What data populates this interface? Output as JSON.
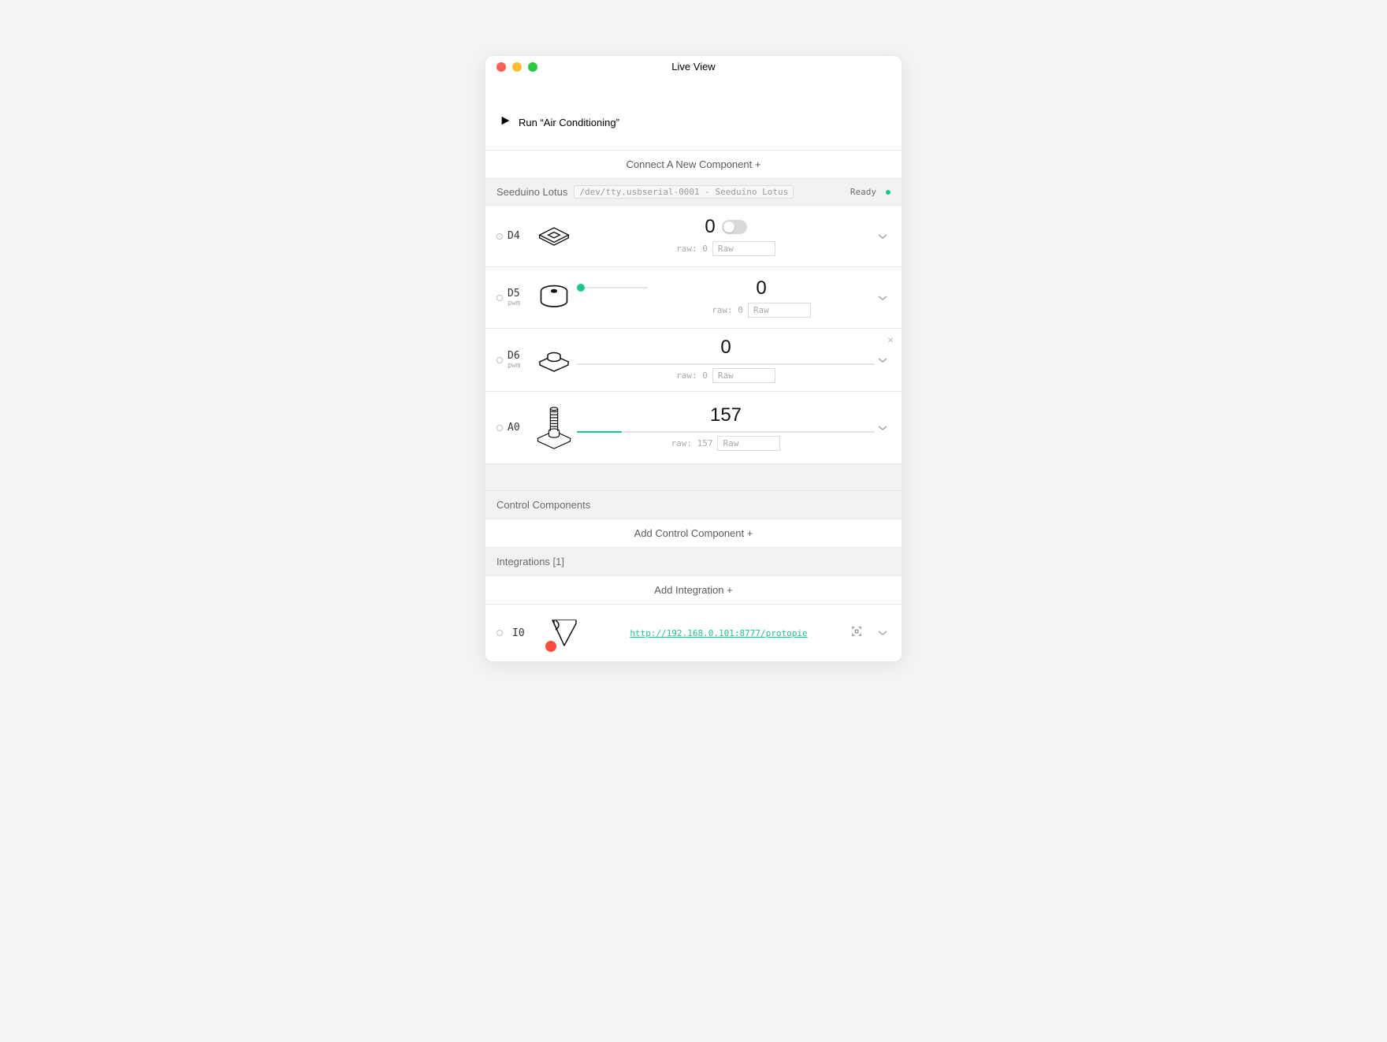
{
  "window": {
    "title": "Live View"
  },
  "run": {
    "label": "Run “Air Conditioning”"
  },
  "connect": {
    "label": "Connect A New Component +"
  },
  "device": {
    "name": "Seeduino Lotus",
    "path": "/dev/tty.usbserial-0001 - Seeduino Lotus",
    "status": "Ready"
  },
  "pins": {
    "d4": {
      "label": "D4",
      "value": "0",
      "raw_label": "raw: 0",
      "raw_mode": "Raw"
    },
    "d5": {
      "label": "D5",
      "sub": "pwm",
      "value": "0",
      "raw_label": "raw: 0",
      "raw_mode": "Raw"
    },
    "d6": {
      "label": "D6",
      "sub": "pwm",
      "value": "0",
      "raw_label": "raw: 0",
      "raw_mode": "Raw"
    },
    "a0": {
      "label": "A0",
      "value": "157",
      "raw_label": "raw: 157",
      "raw_mode": "Raw",
      "fill_pct": 15
    }
  },
  "sections": {
    "control": {
      "header": "Control Components",
      "add": "Add Control Component +"
    },
    "integrations": {
      "header": "Integrations [1]",
      "add": "Add Integration +"
    }
  },
  "integration": {
    "label": "I0",
    "url": "http://192.168.0.101:8777/protopie"
  }
}
